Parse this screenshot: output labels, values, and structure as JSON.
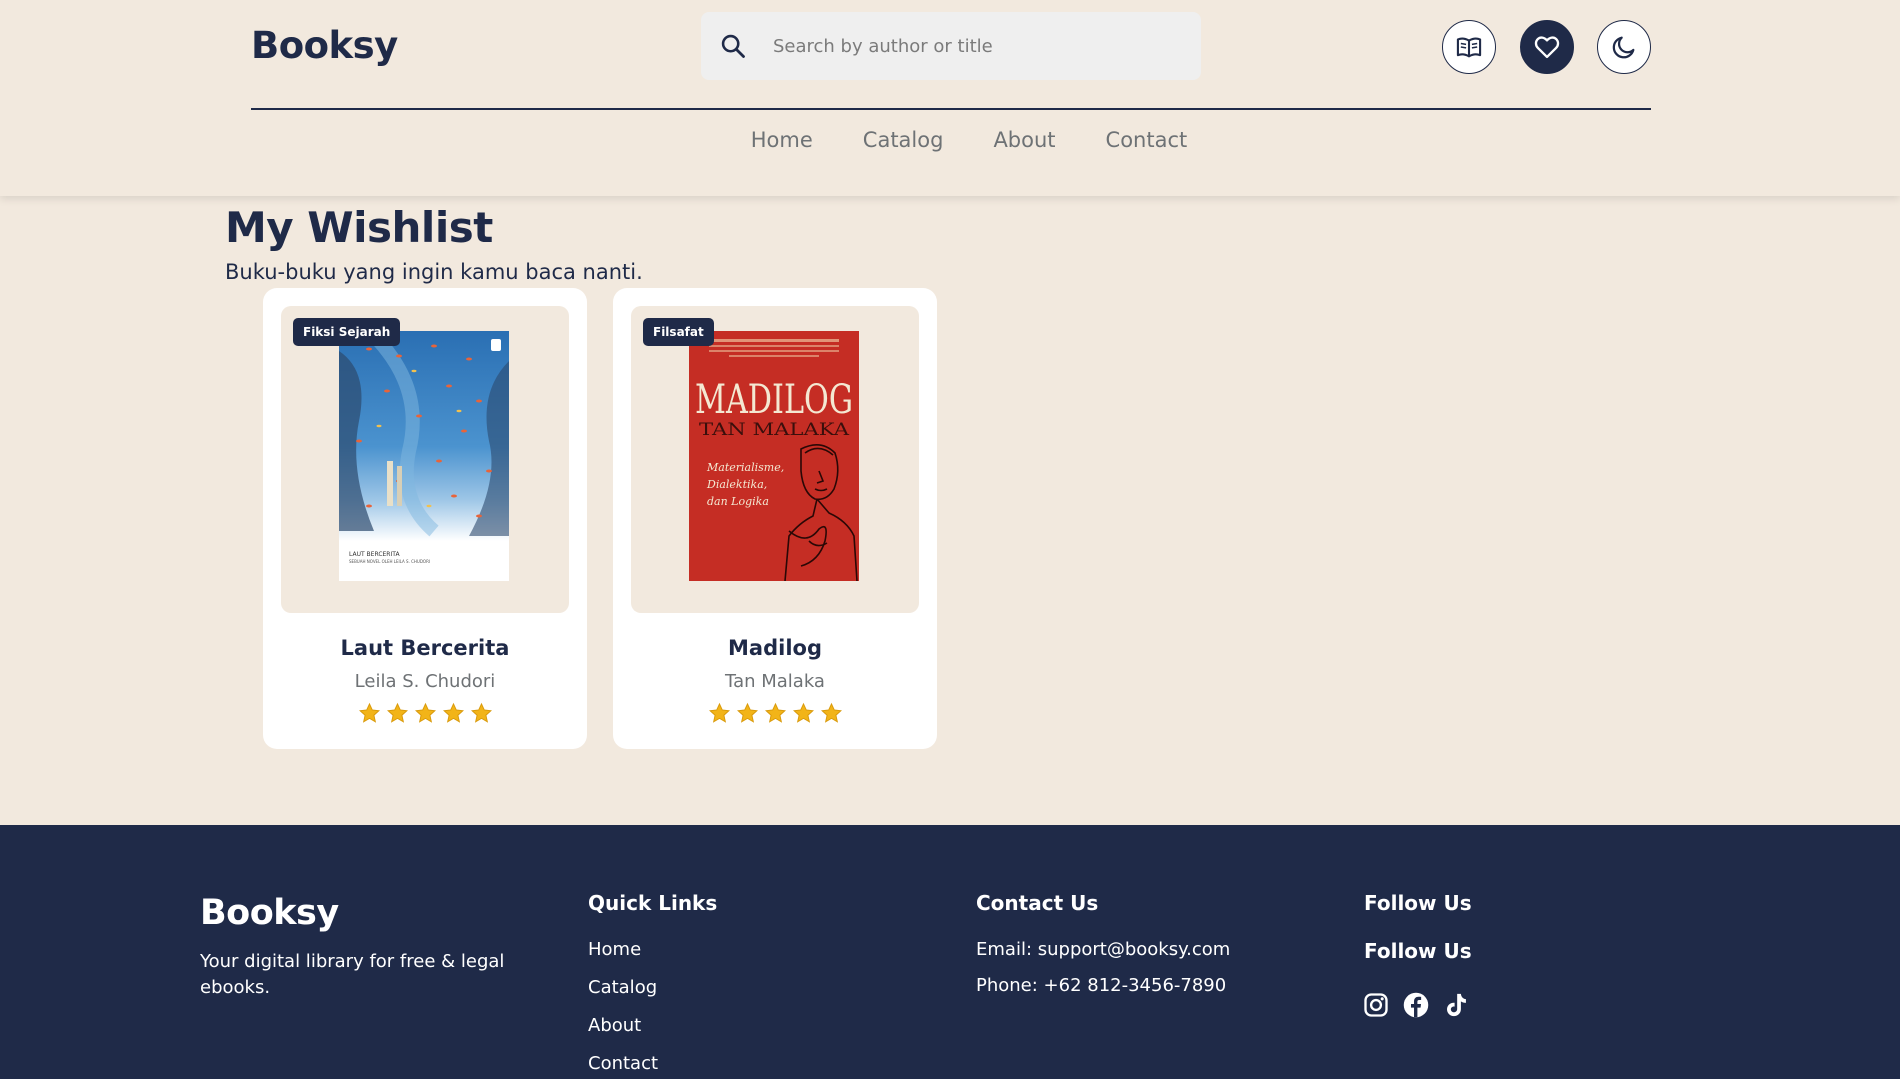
{
  "header": {
    "brand": "Booksy",
    "search_placeholder": "Search by author or title",
    "buttons": {
      "library": "book-open-icon",
      "wishlist": "heart-icon",
      "theme": "moon-icon"
    }
  },
  "nav": {
    "items": [
      "Home",
      "Catalog",
      "About",
      "Contact"
    ]
  },
  "main": {
    "title": "My Wishlist",
    "subtitle": "Buku-buku yang ingin kamu baca nanti.",
    "books": [
      {
        "title": "Laut Bercerita",
        "author": "Leila S. Chudori",
        "tag": "Fiksi Sejarah",
        "rating": 5,
        "cover_small_text_1": "LAUT BERCERITA",
        "cover_small_text_2": "SEBUAH NOVEL OLEH LEILA S. CHUDORI"
      },
      {
        "title": "Madilog",
        "author": "Tan Malaka",
        "tag": "Filsafat",
        "rating": 5,
        "cover_title": "MADILOG",
        "cover_author": "TAN MALAKA",
        "cover_sub_1": "Materialisme,",
        "cover_sub_2": "Dialektika,",
        "cover_sub_3": "dan Logika"
      }
    ]
  },
  "footer": {
    "brand": "Booksy",
    "tagline": "Your digital library for free & legal ebooks.",
    "quick_links_heading": "Quick Links",
    "quick_links": [
      "Home",
      "Catalog",
      "About",
      "Contact"
    ],
    "contact_heading": "Contact Us",
    "email": "Email: support@booksy.com",
    "phone": "Phone: +62 812-3456-7890",
    "follow_heading_1": "Follow Us",
    "follow_heading_2": "Follow Us",
    "socials": [
      "instagram-icon",
      "facebook-icon",
      "tiktok-icon"
    ]
  },
  "colors": {
    "background": "#f2e9de",
    "navy": "#1f2a48",
    "star": "#f2b418",
    "muted": "#6e7275"
  }
}
